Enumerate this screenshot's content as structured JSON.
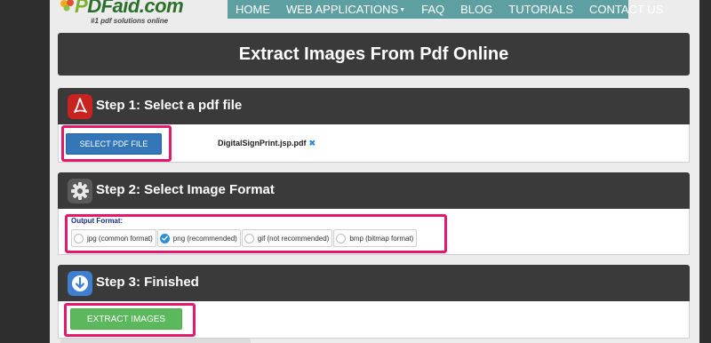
{
  "header": {
    "logo": {
      "prefix": "P",
      "rest": "DFaid.com",
      "tagline": "#1 pdf solutions online"
    },
    "nav": [
      {
        "label": "HOME"
      },
      {
        "label": "WEB APPLICATIONS",
        "has_dropdown": true
      },
      {
        "label": "FAQ"
      },
      {
        "label": "BLOG"
      },
      {
        "label": "TUTORIALS"
      },
      {
        "label": "CONTACT US"
      }
    ]
  },
  "page_title": "Extract Images From Pdf Online",
  "step1": {
    "title": "Step 1: Select a pdf file",
    "icon": "pdf-icon",
    "button_label": "SELECT PDF FILE",
    "file_name": "DigitalSignPrint.jsp.pdf",
    "remove_glyph": "✖"
  },
  "step2": {
    "title": "Step 2: Select Image Format",
    "icon": "gear-icon",
    "output_label": "Output Format:",
    "options": [
      {
        "label": "jpg (common format)",
        "selected": false
      },
      {
        "label": "png (recommended)",
        "selected": true
      },
      {
        "label": "gif (not recommended)",
        "selected": false
      },
      {
        "label": "bmp (bitmap format)",
        "selected": false
      }
    ]
  },
  "step3": {
    "title": "Step 3: Finished",
    "icon": "download-icon",
    "button_label": "EXTRACT IMAGES"
  },
  "colors": {
    "nav_bg": "#5e9fa1",
    "panel_header": "#3a3a3a",
    "highlight": "#e6186b",
    "select_button": "#3477b9",
    "extract_button": "#5cb85c"
  }
}
